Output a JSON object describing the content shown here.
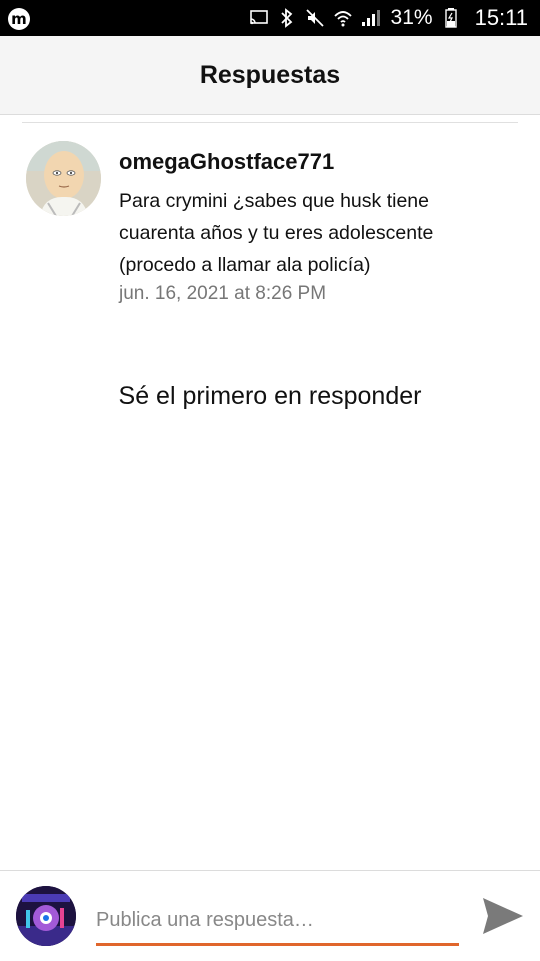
{
  "status_bar": {
    "battery_percent": "31%",
    "time": "15:11",
    "app_icon_letter": "m",
    "icons": [
      "cast-icon",
      "bluetooth-icon",
      "mute-icon",
      "wifi-icon",
      "signal-icon",
      "battery-icon"
    ]
  },
  "header": {
    "title": "Respuestas"
  },
  "comment": {
    "username": "omegaGhostface771",
    "text": "Para crymini ¿sabes que husk tiene cuarenta años y tu eres adolescente (procedo a llamar ala policía)",
    "timestamp": "jun. 16, 2021 at 8:26 PM"
  },
  "empty_state": {
    "message": "Sé el primero en responder"
  },
  "composer": {
    "placeholder": "Publica una respuesta…",
    "accent_color": "#e0662c"
  }
}
